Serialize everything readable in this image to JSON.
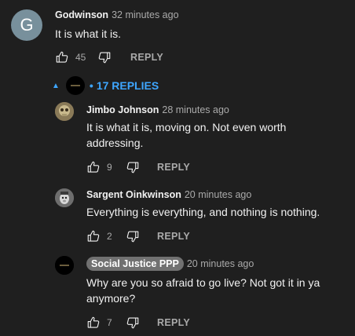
{
  "comment": {
    "avatar_letter": "G",
    "author": "Godwinson",
    "time": "32 minutes ago",
    "text": "It is what it is.",
    "likes": "45",
    "reply_label": "REPLY"
  },
  "replies_toggle": {
    "label": "17 REPLIES",
    "dot": "•"
  },
  "replies": [
    {
      "author": "Jimbo Johnson",
      "time": "28 minutes ago",
      "text_lines": [
        "It is what it is, moving on.  Not even worth",
        "addressing."
      ],
      "likes": "9",
      "reply_label": "REPLY"
    },
    {
      "author": "Sargent Oinkwinson",
      "time": "20 minutes ago",
      "text_lines": [
        "Everything is everything, and nothing is nothing."
      ],
      "likes": "2",
      "reply_label": "REPLY"
    },
    {
      "author": "Social Justice PPP",
      "time": "20 minutes ago",
      "text_lines": [
        "Why are you so afraid to go live? Not got it in ya",
        "anymore?"
      ],
      "likes": "7",
      "reply_label": "REPLY"
    }
  ],
  "icons": {
    "like": "thumbs-up-icon",
    "dislike": "thumbs-down-icon"
  },
  "colors": {
    "background": "#1f1f1f",
    "link_blue": "#3ea6ff",
    "avatar_letter_bg": "#78909c",
    "badge_bg": "#717171"
  }
}
